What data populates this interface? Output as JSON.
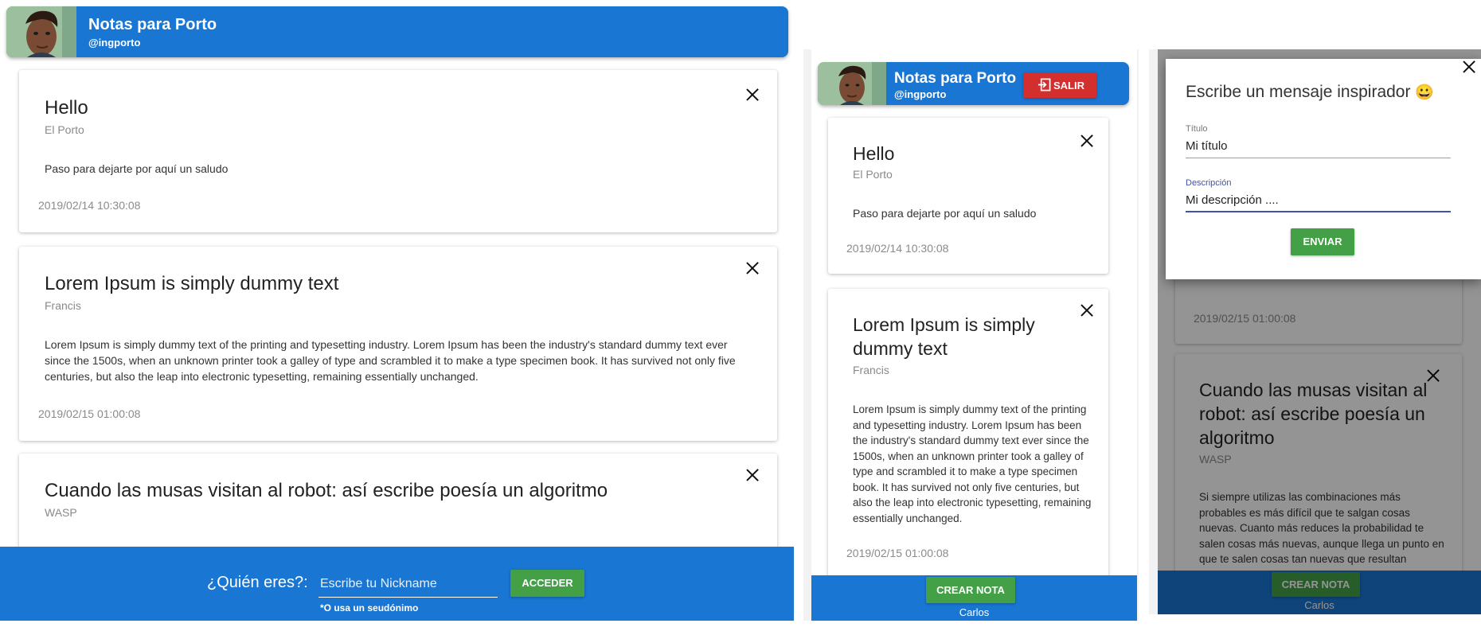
{
  "app": {
    "title": "Notas para Porto",
    "handle": "@ingporto"
  },
  "notes": [
    {
      "title": "Hello",
      "author": "El Porto",
      "body": "Paso para dejarte por aquí un saludo",
      "date": "2019/02/14 10:30:08"
    },
    {
      "title": "Lorem Ipsum is simply dummy text",
      "author": "Francis",
      "body": "Lorem Ipsum is simply dummy text of the printing and typesetting industry. Lorem Ipsum has been the industry's standard dummy text ever since the 1500s, when an unknown printer took a galley of type and scrambled it to make a type specimen book. It has survived not only five centuries, but also the leap into electronic typesetting, remaining essentially unchanged.",
      "date": "2019/02/15 01:00:08"
    },
    {
      "title": "Cuando las musas visitan al robot: así escribe poesía un algoritmo",
      "author": "WASP",
      "body": "Si siempre utilizas las combinaciones más probables es más difícil que te salgan cosas nuevas. Cuanto más reduces la probabilidad te salen cosas más nuevas, aunque llega un punto en que te salen cosas tan nuevas que resultan incorrectas."
    }
  ],
  "login": {
    "prompt": "¿Quién eres?:",
    "nickname_placeholder": "Escribe tu Nickname",
    "hint": "*O usa un seudónimo",
    "submit": "ACCEDER"
  },
  "session": {
    "logout": "SALIR",
    "create_note": "CREAR NOTA",
    "user": "Carlos"
  },
  "dialog": {
    "heading": "Escribe un mensaje inspirador",
    "emoji": "😀",
    "title_label": "Título",
    "title_value": "Mi título",
    "desc_label": "Descripción",
    "desc_value": "Mi descripción ....",
    "send": "ENVIAR"
  },
  "colors": {
    "primary": "#1976d2",
    "success": "#43a047",
    "danger": "#d32f2f"
  }
}
